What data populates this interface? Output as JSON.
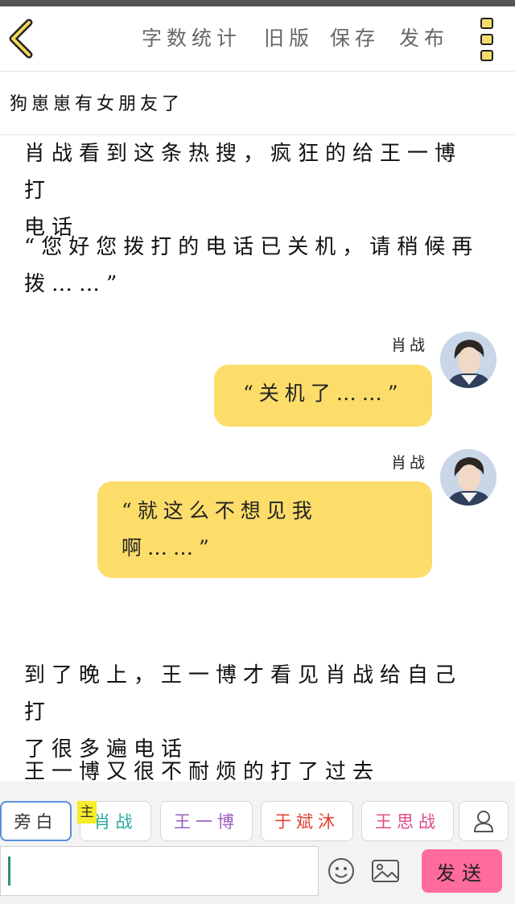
{
  "toolbar": {
    "actions": [
      "字数统计",
      "旧版",
      "保存",
      "发布"
    ]
  },
  "title": "狗崽崽有女朋友了",
  "story": {
    "para1": [
      "肖战看到这条热搜，疯狂的给王一博打",
      "电话"
    ],
    "para2": [
      "“您好您拨打的电话已关机，请稍候再",
      "拨……”"
    ],
    "messages": [
      {
        "speaker": "肖战",
        "text": [
          "“关机了……”"
        ]
      },
      {
        "speaker": "肖战",
        "text": [
          "“就这么不想见我",
          "啊……”"
        ]
      }
    ],
    "para3": [
      "到了晚上，王一博才看见肖战给自己打",
      "了很多遍电话"
    ],
    "para4": [
      "王一博又很不耐烦的打了过去"
    ]
  },
  "roles": {
    "narrator": "旁白",
    "main_tag": "主",
    "items": [
      {
        "label": "肖战",
        "color": "#27a9a0"
      },
      {
        "label": "王一博",
        "color": "#9b5fc0"
      },
      {
        "label": "于斌沐",
        "color": "#e0442f"
      },
      {
        "label": "王思战",
        "color": "#e0488a"
      }
    ]
  },
  "input": {
    "value": ""
  },
  "send_label": "发送",
  "colors": {
    "bubble": "#fcdd6a",
    "send": "#ff6b9f",
    "active_border": "#5b8fd8"
  },
  "icons": [
    "back-arrow-icon",
    "menu-icon",
    "avatar-image",
    "person-icon",
    "emoji-icon",
    "image-icon"
  ]
}
